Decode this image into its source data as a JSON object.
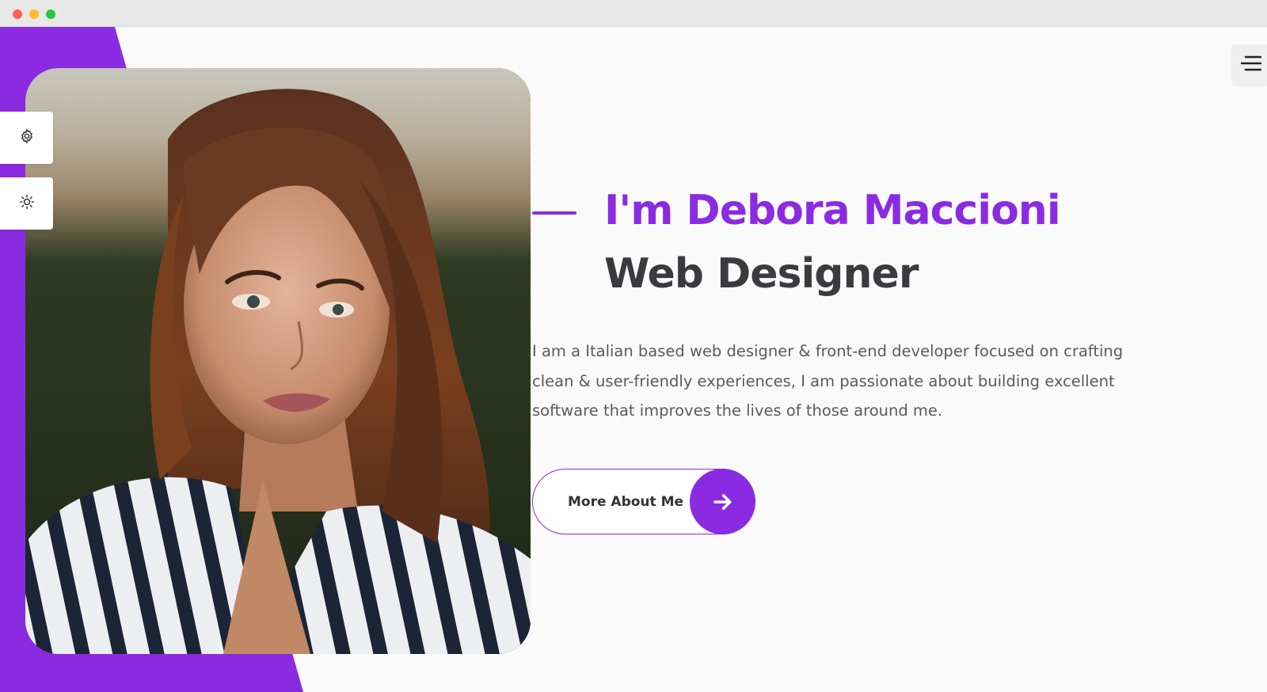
{
  "window": {
    "controls": [
      "close",
      "minimize",
      "maximize"
    ]
  },
  "theme": {
    "accent": "#8a2be2",
    "dark_text": "#3b3b3f",
    "body_text": "#5a5a5f",
    "background": "#fafafa"
  },
  "tools": {
    "settings_icon": "gear-icon",
    "theme_icon": "sun-icon"
  },
  "header": {
    "menu_icon": "hamburger-menu-icon"
  },
  "hero": {
    "title": "I'm Debora Maccioni",
    "subtitle": "Web Designer",
    "description": "I am a Italian based web designer & front-end developer focused on crafting clean & user-friendly experiences, I am passionate about building excellent software that improves the lives of those around me.",
    "cta_label": "More About Me",
    "cta_icon": "arrow-right-icon"
  },
  "photo": {
    "subject": "portrait-photo"
  }
}
